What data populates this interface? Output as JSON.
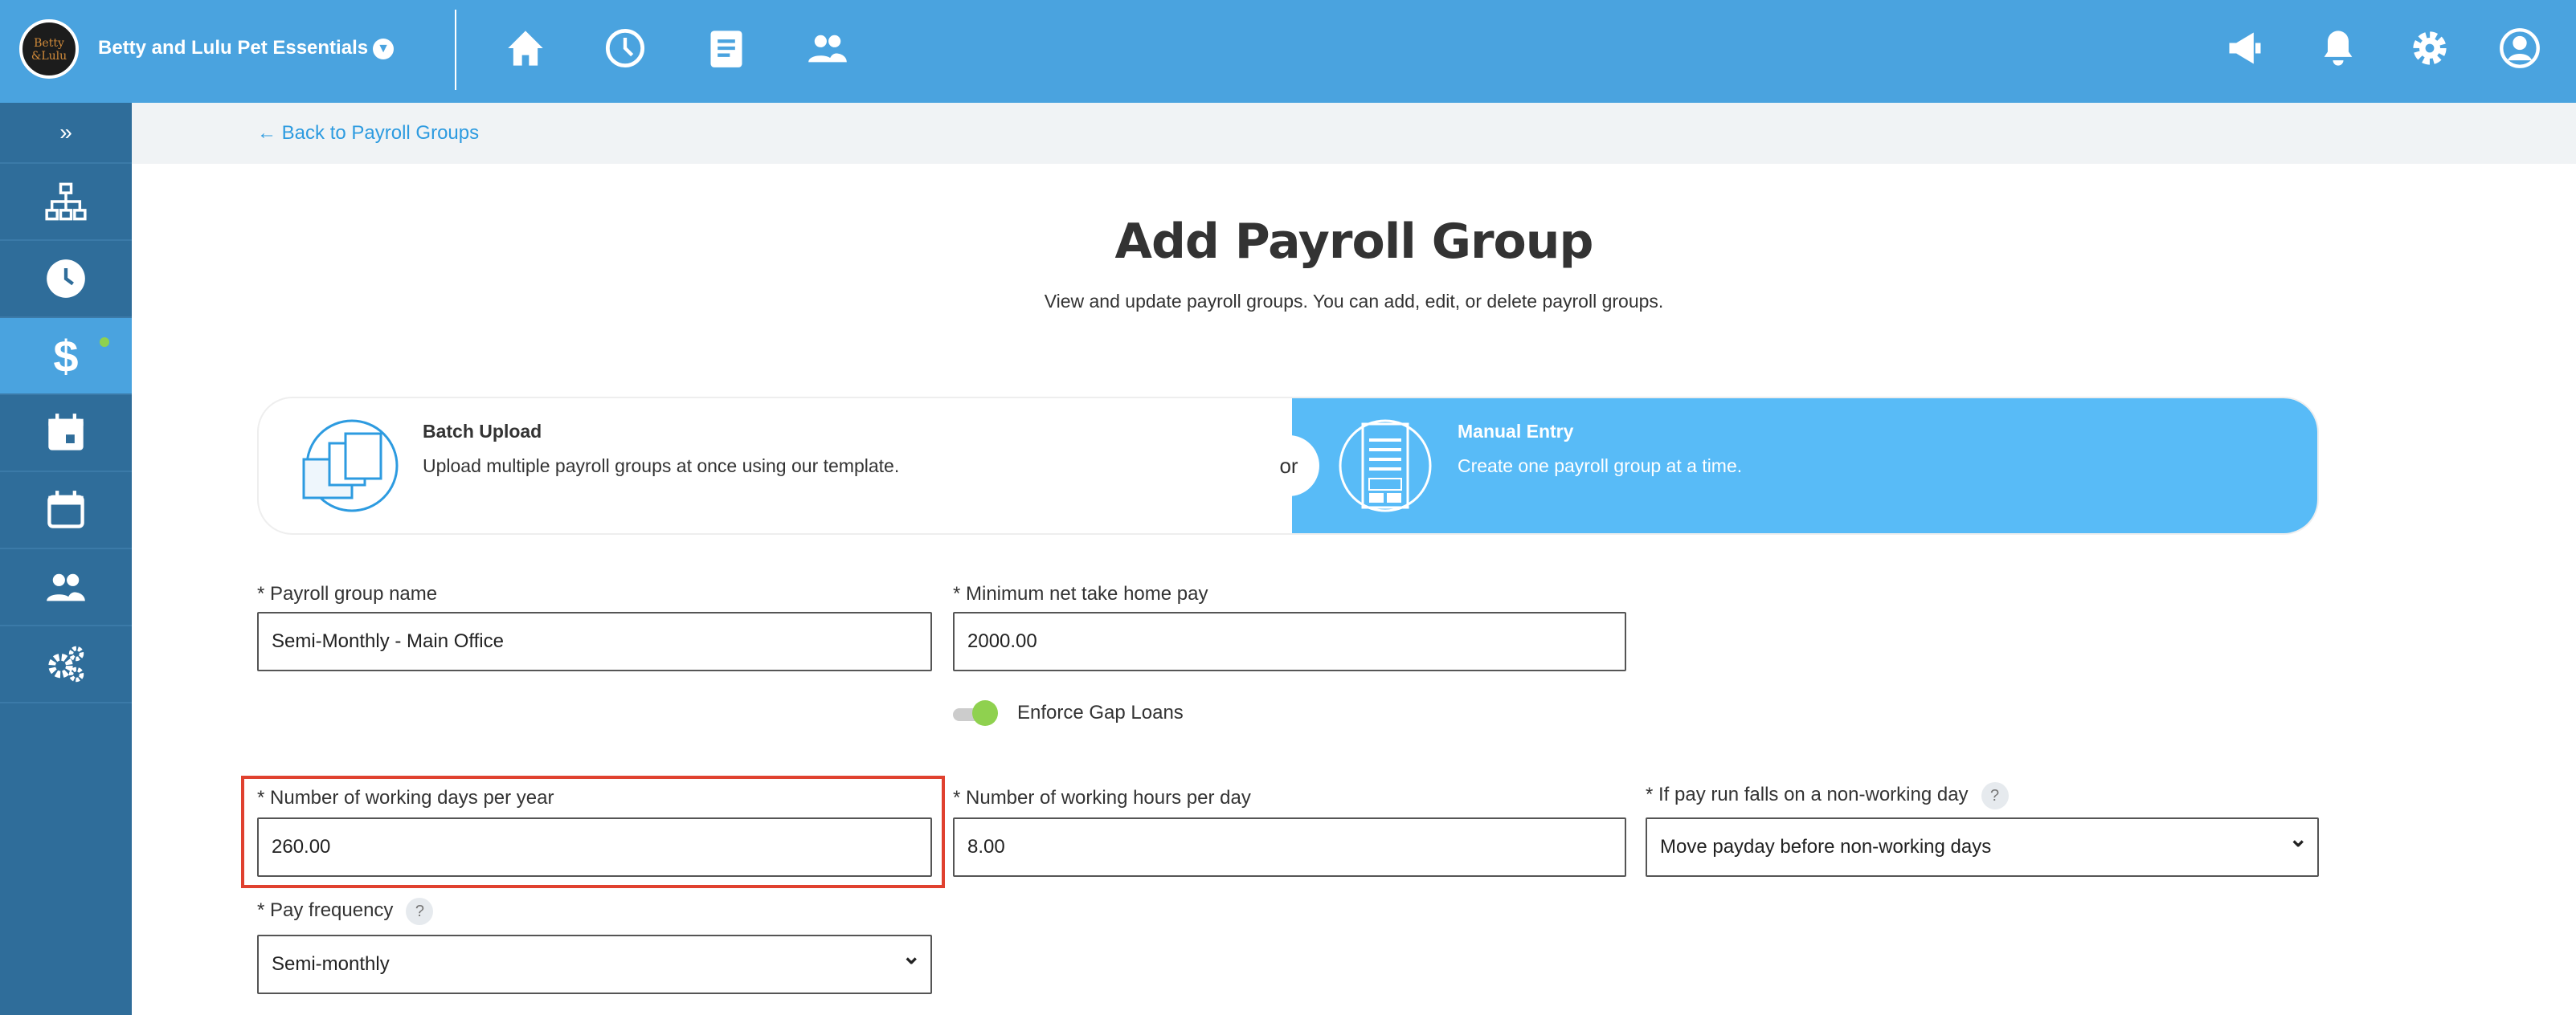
{
  "topbar": {
    "logo_text": "Betty & Lulu",
    "company": "Betty and Lulu Pet Essentials",
    "nav_icons": [
      "home-icon",
      "clock-icon",
      "document-icon",
      "people-icon"
    ],
    "right_icons": [
      "megaphone-icon",
      "bell-icon",
      "gear-icon",
      "user-icon"
    ]
  },
  "sidebar": {
    "expand": "»",
    "items": [
      "org-chart-icon",
      "clock-icon",
      "dollar-icon",
      "calendar-day-icon",
      "calendar-icon",
      "people-icon",
      "gears-icon"
    ],
    "active": "dollar-icon"
  },
  "back_link": "← Back to Payroll Groups",
  "page": {
    "title": "Add Payroll Group",
    "subtitle": "View and update payroll groups. You can add, edit, or delete payroll groups."
  },
  "mode": {
    "batch_title": "Batch Upload",
    "batch_desc": "Upload multiple payroll groups at once using our template.",
    "or": "or",
    "manual_title": "Manual Entry",
    "manual_desc": "Create one payroll group at a time.",
    "selected": "Manual Entry"
  },
  "form": {
    "group_name_label": "* Payroll group name",
    "group_name": "Semi-Monthly - Main Office",
    "min_pay_label": "* Minimum net take home pay",
    "min_pay": "2000.00",
    "gap_loans_label": "Enforce Gap Loans",
    "gap_loans_on": true,
    "days_label": "* Number of working days per year",
    "days": "260.00",
    "hours_label": "* Number of working hours per day",
    "hours": "8.00",
    "nonwork_label": "* If pay run falls on a non-working day",
    "nonwork": "Move payday before non-working days",
    "freq_label": "* Pay frequency",
    "freq": "Semi-monthly",
    "help": "?"
  },
  "colors": {
    "topbar": "#4aa3df",
    "sidebar": "#2f6d9a",
    "manual_card": "#58bbf7",
    "highlight": "#e0412f",
    "toggle": "#8fd14f"
  }
}
